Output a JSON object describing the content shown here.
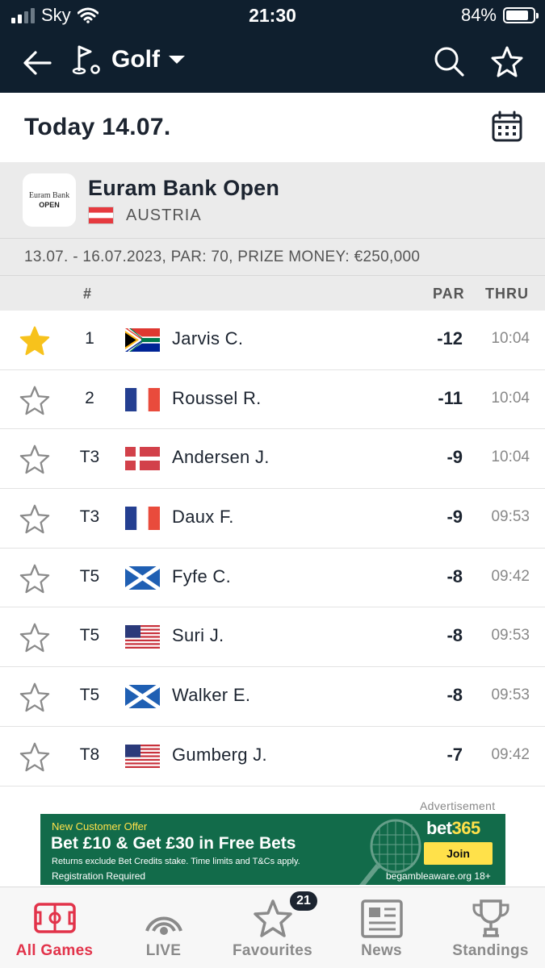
{
  "status_bar": {
    "carrier": "Sky",
    "time": "21:30",
    "battery": "84%",
    "battery_level": 0.84
  },
  "nav": {
    "sport": "Golf"
  },
  "date_row": {
    "title": "Today 14.07."
  },
  "tournament": {
    "logo_line1": "Euram Bank",
    "logo_line2": "OPEN",
    "name": "Euram Bank Open",
    "country": "AUSTRIA",
    "info": "13.07. - 16.07.2023, PAR: 70, PRIZE MONEY: €250,000"
  },
  "columns": {
    "position": "#",
    "par": "PAR",
    "thru": "THRU"
  },
  "leaderboard": [
    {
      "pos": "1",
      "name": "Jarvis C.",
      "par": "-12",
      "thru": "10:04",
      "flag": "south-africa",
      "favourite": true
    },
    {
      "pos": "2",
      "name": "Roussel R.",
      "par": "-11",
      "thru": "10:04",
      "flag": "france",
      "favourite": false
    },
    {
      "pos": "T3",
      "name": "Andersen J.",
      "par": "-9",
      "thru": "10:04",
      "flag": "denmark",
      "favourite": false
    },
    {
      "pos": "T3",
      "name": "Daux F.",
      "par": "-9",
      "thru": "09:53",
      "flag": "france",
      "favourite": false
    },
    {
      "pos": "T5",
      "name": "Fyfe C.",
      "par": "-8",
      "thru": "09:42",
      "flag": "scotland",
      "favourite": false
    },
    {
      "pos": "T5",
      "name": "Suri J.",
      "par": "-8",
      "thru": "09:53",
      "flag": "usa",
      "favourite": false
    },
    {
      "pos": "T5",
      "name": "Walker E.",
      "par": "-8",
      "thru": "09:53",
      "flag": "scotland",
      "favourite": false
    },
    {
      "pos": "T8",
      "name": "Gumberg J.",
      "par": "-7",
      "thru": "09:42",
      "flag": "usa",
      "favourite": false
    }
  ],
  "ad": {
    "label": "Advertisement",
    "offer": "New Customer Offer",
    "headline": "Bet £10 & Get £30 in Free Bets",
    "terms": "Returns exclude Bet Credits stake. Time limits and T&Cs apply.",
    "registration": "Registration Required",
    "brand_a": "bet",
    "brand_b": "365",
    "join": "Join",
    "gamble": "begambleaware.org 18+"
  },
  "tabs": [
    {
      "label": "All Games",
      "icon": "pitch-icon",
      "active": true
    },
    {
      "label": "LIVE",
      "icon": "live-icon",
      "active": false
    },
    {
      "label": "Favourites",
      "icon": "star-icon",
      "active": false
    },
    {
      "label": "News",
      "icon": "news-icon",
      "active": false
    },
    {
      "label": "Standings",
      "icon": "trophy-icon",
      "active": false
    }
  ],
  "favourites_badge": "21",
  "colors": {
    "header": "#0f1f2e",
    "accent": "#e2334a",
    "favourite_star": "#f7c21c",
    "ad_green": "#126b4a"
  }
}
